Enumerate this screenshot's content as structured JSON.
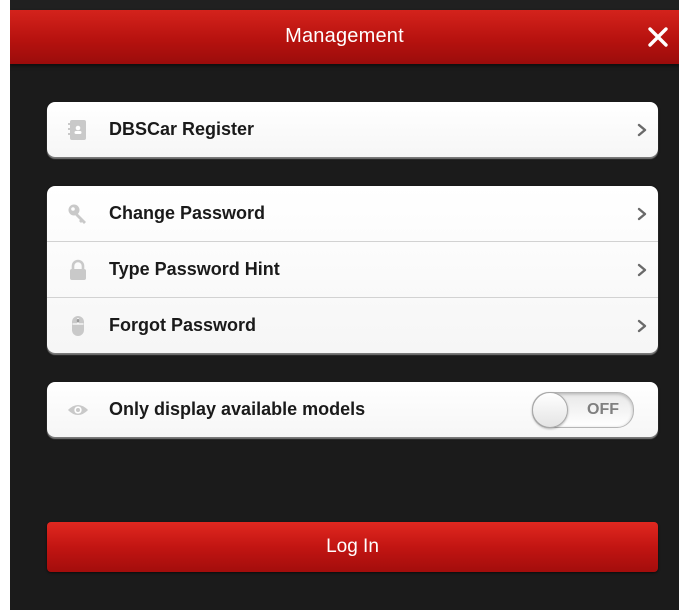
{
  "header": {
    "title": "Management",
    "close_icon": "close-icon"
  },
  "groups": [
    {
      "items": [
        {
          "label": "DBSCar Register",
          "icon": "register-card-icon"
        }
      ]
    },
    {
      "items": [
        {
          "label": "Change Password",
          "icon": "key-icon"
        },
        {
          "label": "Type Password Hint",
          "icon": "lock-icon"
        },
        {
          "label": "Forgot Password",
          "icon": "mouse-icon"
        }
      ]
    },
    {
      "items": [
        {
          "label": "Only display available models",
          "icon": "eye-icon",
          "toggle": {
            "state": "OFF",
            "on": false
          }
        }
      ]
    }
  ],
  "login": {
    "label": "Log In"
  },
  "colors": {
    "accent_red": "#c21512",
    "background": "#1b1b1b",
    "row_text": "#1a1a1a",
    "icon_gray": "#c4c4c4"
  }
}
